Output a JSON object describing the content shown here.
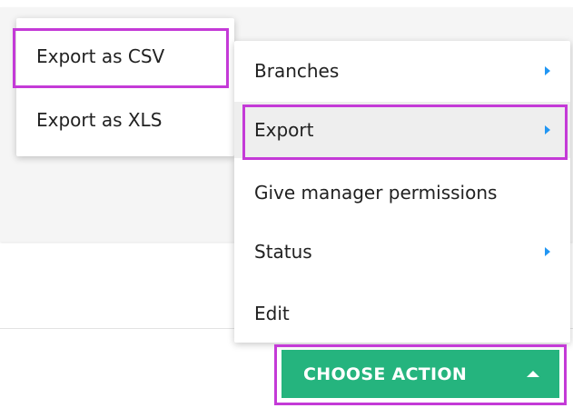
{
  "submenu": {
    "items": [
      {
        "label": "Export as CSV"
      },
      {
        "label": "Export as XLS"
      }
    ]
  },
  "main_menu": {
    "items": [
      {
        "label": "Branches",
        "has_submenu": true
      },
      {
        "label": "Export",
        "has_submenu": true,
        "active": true
      },
      {
        "label": "Give manager permissions",
        "has_submenu": false
      },
      {
        "label": "Status",
        "has_submenu": true
      },
      {
        "label": "Edit",
        "has_submenu": false
      }
    ]
  },
  "action_button": {
    "label": "CHOOSE ACTION",
    "icon": "caret-up-icon"
  },
  "colors": {
    "accent_green": "#25b47e",
    "highlight_magenta": "#c43ad7",
    "caret_blue": "#2196f3",
    "active_item_bg": "#eeeeee"
  }
}
